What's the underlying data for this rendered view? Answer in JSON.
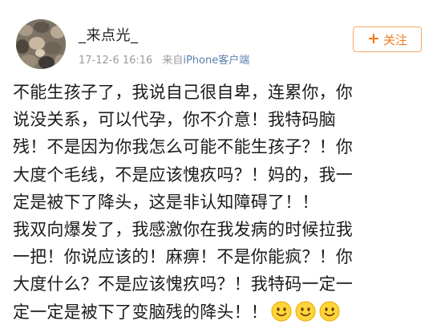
{
  "user": {
    "username": "_来点光_",
    "timestamp": "17-12-6 16:16",
    "source_prefix": "来自",
    "source_device": "iPhone客户端",
    "avatar_icon": "avatar-image"
  },
  "follow_button": {
    "icon": "plus-icon",
    "plus_glyph": "+",
    "label": "关注",
    "border_color": "#f3a968",
    "text_color": "#f07d21"
  },
  "post": {
    "lines": [
      "不能生孩子了，我说自己很自卑，连累你，你",
      "说没关系，可以代孕，你不介意！我特码脑",
      "残！不是因为你我怎么可能不能生孩子？！你",
      "大度个毛线，不是应该愧疚吗？！妈的，我一",
      "定是被下了降头，这是非认知障碍了！！",
      "我双向爆发了，我感激你在我发病的时候拉我",
      "一把！你说应该的！麻痹！不是你能疯？！你",
      "大度什么？不是应该愧疚吗？！我特码一定一",
      "定一定是被下了变脑残的降头！！"
    ],
    "emojis": [
      "smile-emoji",
      "smile-emoji",
      "smile-emoji"
    ]
  }
}
